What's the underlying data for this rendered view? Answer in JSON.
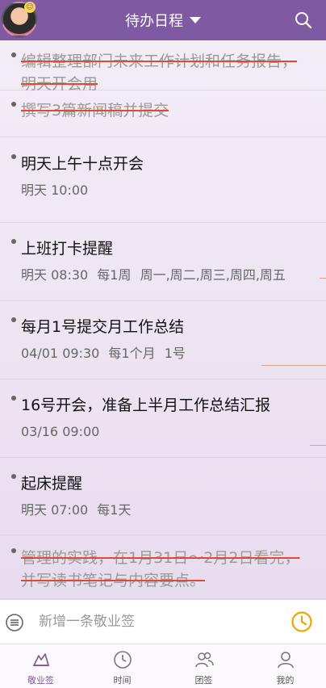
{
  "header": {
    "title": "待办日程",
    "avatar_badge": "☺"
  },
  "todos": [
    {
      "title": "编辑整理部门未来工作计划和任务报告，明天开会用",
      "done": true
    },
    {
      "title": "撰写3篇新闻稿并提交",
      "done": true
    },
    {
      "title": "明天上午十点开会",
      "done": false,
      "time": "明天 10:00",
      "repeat": "",
      "days": ""
    },
    {
      "title": "上班打卡提醒",
      "done": false,
      "time": "明天 08:30",
      "repeat": "每1周",
      "days": "周一,周二,周三,周四,周五"
    },
    {
      "title": "每月1号提交月工作总结",
      "done": false,
      "time": "04/01 09:30",
      "repeat": "每1个月",
      "days": "1号"
    },
    {
      "title": "16号开会，准备上半月工作总结汇报",
      "done": false,
      "time": "03/16 09:00",
      "repeat": "",
      "days": ""
    },
    {
      "title": "起床提醒",
      "done": false,
      "time": "明天 07:00",
      "repeat": "每1天",
      "days": ""
    },
    {
      "title": "管理的实践，在1月31日～2月2日看完，并写读书笔记与内容要点。",
      "done": true
    }
  ],
  "input": {
    "placeholder": "新增一条敬业签"
  },
  "tabs": [
    {
      "label": "敬业签",
      "icon": "note-icon",
      "active": true
    },
    {
      "label": "时间",
      "icon": "clock-icon",
      "active": false
    },
    {
      "label": "团签",
      "icon": "team-icon",
      "active": false
    },
    {
      "label": "我的",
      "icon": "person-icon",
      "active": false
    }
  ],
  "colors": {
    "brand": "#7f5aa3",
    "strike": "#e04a2f",
    "clock_accent": "#f0a500"
  }
}
